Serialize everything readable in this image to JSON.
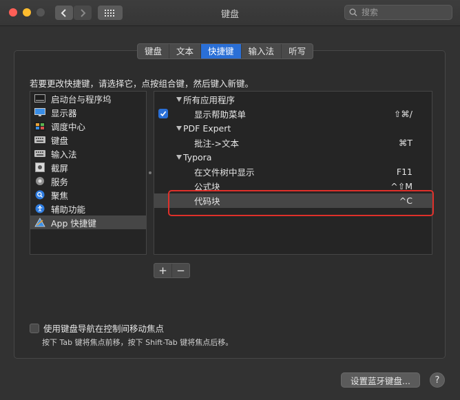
{
  "window": {
    "title": "键盘"
  },
  "search": {
    "placeholder": "搜索"
  },
  "tabs": [
    {
      "label": "键盘",
      "active": false
    },
    {
      "label": "文本",
      "active": false
    },
    {
      "label": "快捷键",
      "active": true
    },
    {
      "label": "输入法",
      "active": false
    },
    {
      "label": "听写",
      "active": false
    }
  ],
  "instruction": "若要更改快捷键，请选择它，点按组合键，然后键入新键。",
  "categories": [
    {
      "label": "启动台与程序坞",
      "icon": "dock-icon"
    },
    {
      "label": "显示器",
      "icon": "display-icon"
    },
    {
      "label": "调度中心",
      "icon": "mission-control-icon"
    },
    {
      "label": "键盘",
      "icon": "keyboard-icon"
    },
    {
      "label": "输入法",
      "icon": "input-method-icon"
    },
    {
      "label": "截屏",
      "icon": "screenshot-icon"
    },
    {
      "label": "服务",
      "icon": "gear-icon"
    },
    {
      "label": "聚焦",
      "icon": "spotlight-icon"
    },
    {
      "label": "辅助功能",
      "icon": "accessibility-icon"
    },
    {
      "label": "App 快捷键",
      "icon": "app-shortcuts-icon",
      "selected": true
    }
  ],
  "shortcuts": [
    {
      "type": "group",
      "label": "所有应用程序"
    },
    {
      "type": "item",
      "label": "显示帮助菜单",
      "shortcut": "⇧⌘/",
      "checked": true
    },
    {
      "type": "group",
      "label": "PDF Expert"
    },
    {
      "type": "item",
      "label": "批注->文本",
      "shortcut": "⌘T"
    },
    {
      "type": "group",
      "label": "Typora"
    },
    {
      "type": "item",
      "label": "在文件树中显示",
      "shortcut": "F11"
    },
    {
      "type": "item",
      "label": "公式块",
      "shortcut": "^⇧M"
    },
    {
      "type": "item",
      "label": "代码块",
      "shortcut": "^C",
      "selected": true
    }
  ],
  "buttons": {
    "add": "+",
    "remove": "−",
    "bluetooth": "设置蓝牙键盘...",
    "help": "?"
  },
  "keyboard_nav": {
    "label": "使用键盘导航在控制间移动焦点",
    "hint": "按下 Tab 键将焦点前移，按下 Shift-Tab 键将焦点后移。",
    "checked": false
  },
  "colors": {
    "accent": "#2a6fd6",
    "highlight_box": "#e0302a"
  }
}
